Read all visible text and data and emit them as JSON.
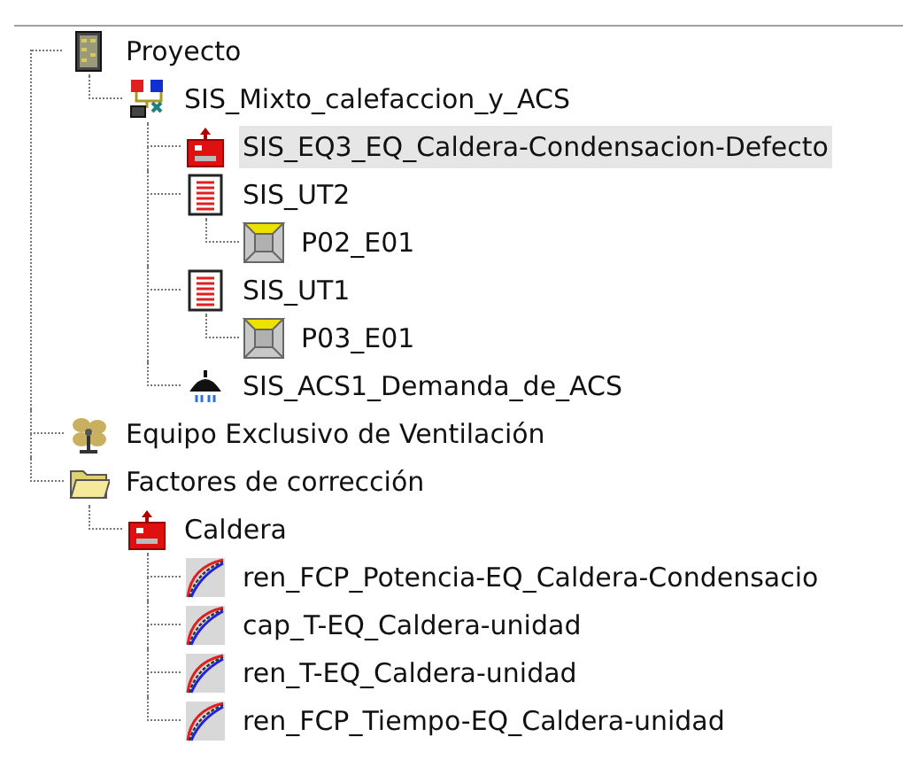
{
  "tree": [
    {
      "label": "Proyecto",
      "kind": "project",
      "selected": false,
      "children": [
        {
          "label": "SIS_Mixto_calefaccion_y_ACS",
          "kind": "system",
          "selected": false,
          "children": [
            {
              "label": "SIS_EQ3_EQ_Caldera-Condensacion-Defecto",
              "kind": "boiler",
              "selected": true
            },
            {
              "label": "SIS_UT2",
              "kind": "emitter",
              "selected": false,
              "children": [
                {
                  "label": "P02_E01",
                  "kind": "space",
                  "selected": false
                }
              ]
            },
            {
              "label": "SIS_UT1",
              "kind": "emitter",
              "selected": false,
              "children": [
                {
                  "label": "P03_E01",
                  "kind": "space",
                  "selected": false
                }
              ]
            },
            {
              "label": "SIS_ACS1_Demanda_de_ACS",
              "kind": "dhw",
              "selected": false
            }
          ]
        }
      ]
    },
    {
      "label": "Equipo Exclusivo de Ventilación",
      "kind": "fan",
      "selected": false
    },
    {
      "label": "Factores de corrección",
      "kind": "folder",
      "selected": false,
      "children": [
        {
          "label": "Caldera",
          "kind": "boiler",
          "selected": false,
          "children": [
            {
              "label": "ren_FCP_Potencia-EQ_Caldera-Condensacio",
              "kind": "curve",
              "selected": false
            },
            {
              "label": "cap_T-EQ_Caldera-unidad",
              "kind": "curve",
              "selected": false
            },
            {
              "label": "ren_T-EQ_Caldera-unidad",
              "kind": "curve",
              "selected": false
            },
            {
              "label": "ren_FCP_Tiempo-EQ_Caldera-unidad",
              "kind": "curve",
              "selected": false
            }
          ]
        }
      ]
    }
  ]
}
